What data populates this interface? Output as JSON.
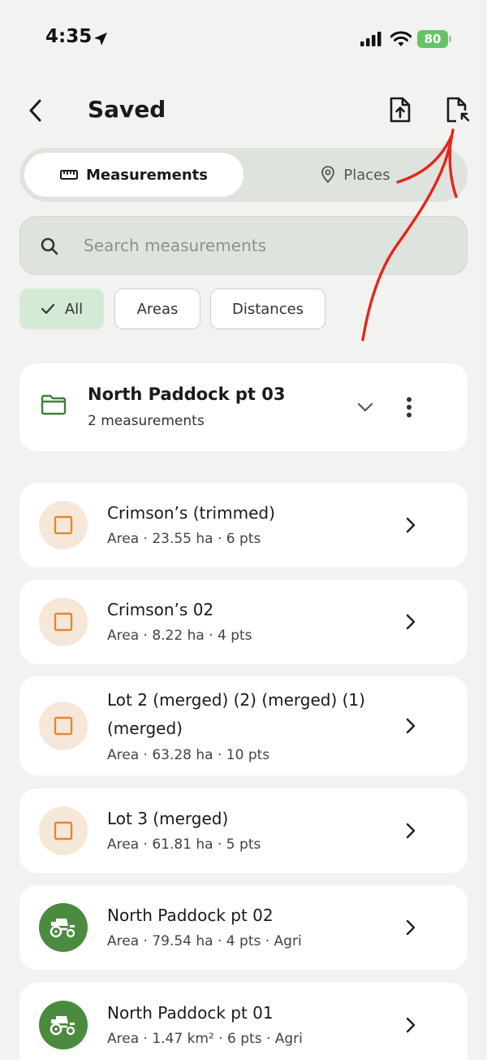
{
  "status_bar": {
    "time": "4:35",
    "battery": "80",
    "icons": [
      "location-arrow-icon",
      "signal-icon",
      "wifi-icon",
      "battery-icon"
    ]
  },
  "header": {
    "title": "Saved",
    "icons": [
      "back-chevron-icon",
      "export-file-icon",
      "import-file-icon"
    ]
  },
  "tabs": {
    "measurements_label": "Measurements",
    "places_label": "Places"
  },
  "search": {
    "placeholder": "Search measurements",
    "value": ""
  },
  "filters": {
    "all": "All",
    "areas": "Areas",
    "distances": "Distances"
  },
  "folder": {
    "title": "North Paddock pt 03",
    "subtitle": "2 measurements"
  },
  "items": [
    {
      "title": "Crimson’s (trimmed)",
      "subtitle": "Area · 23.55 ha · 6 pts",
      "kind": "area"
    },
    {
      "title": "Crimson’s 02",
      "subtitle": "Area · 8.22 ha · 4 pts",
      "kind": "area"
    },
    {
      "title": "Lot 2 (merged) (2) (merged) (1) (merged)",
      "subtitle": "Area · 63.28 ha · 10 pts",
      "kind": "area"
    },
    {
      "title": "Lot 3 (merged)",
      "subtitle": "Area · 61.81 ha · 5 pts",
      "kind": "area"
    },
    {
      "title": "North Paddock pt 02",
      "subtitle": "Area · 79.54 ha · 4 pts · Agri",
      "kind": "agri"
    },
    {
      "title": "North Paddock pt 01",
      "subtitle": "Area · 1.47 km² · 6 pts · Agri",
      "kind": "agri"
    }
  ],
  "colors": {
    "accent_green": "#4b8b3f",
    "area_orange": "#d98b3a",
    "annotation_red": "#e4261b"
  }
}
